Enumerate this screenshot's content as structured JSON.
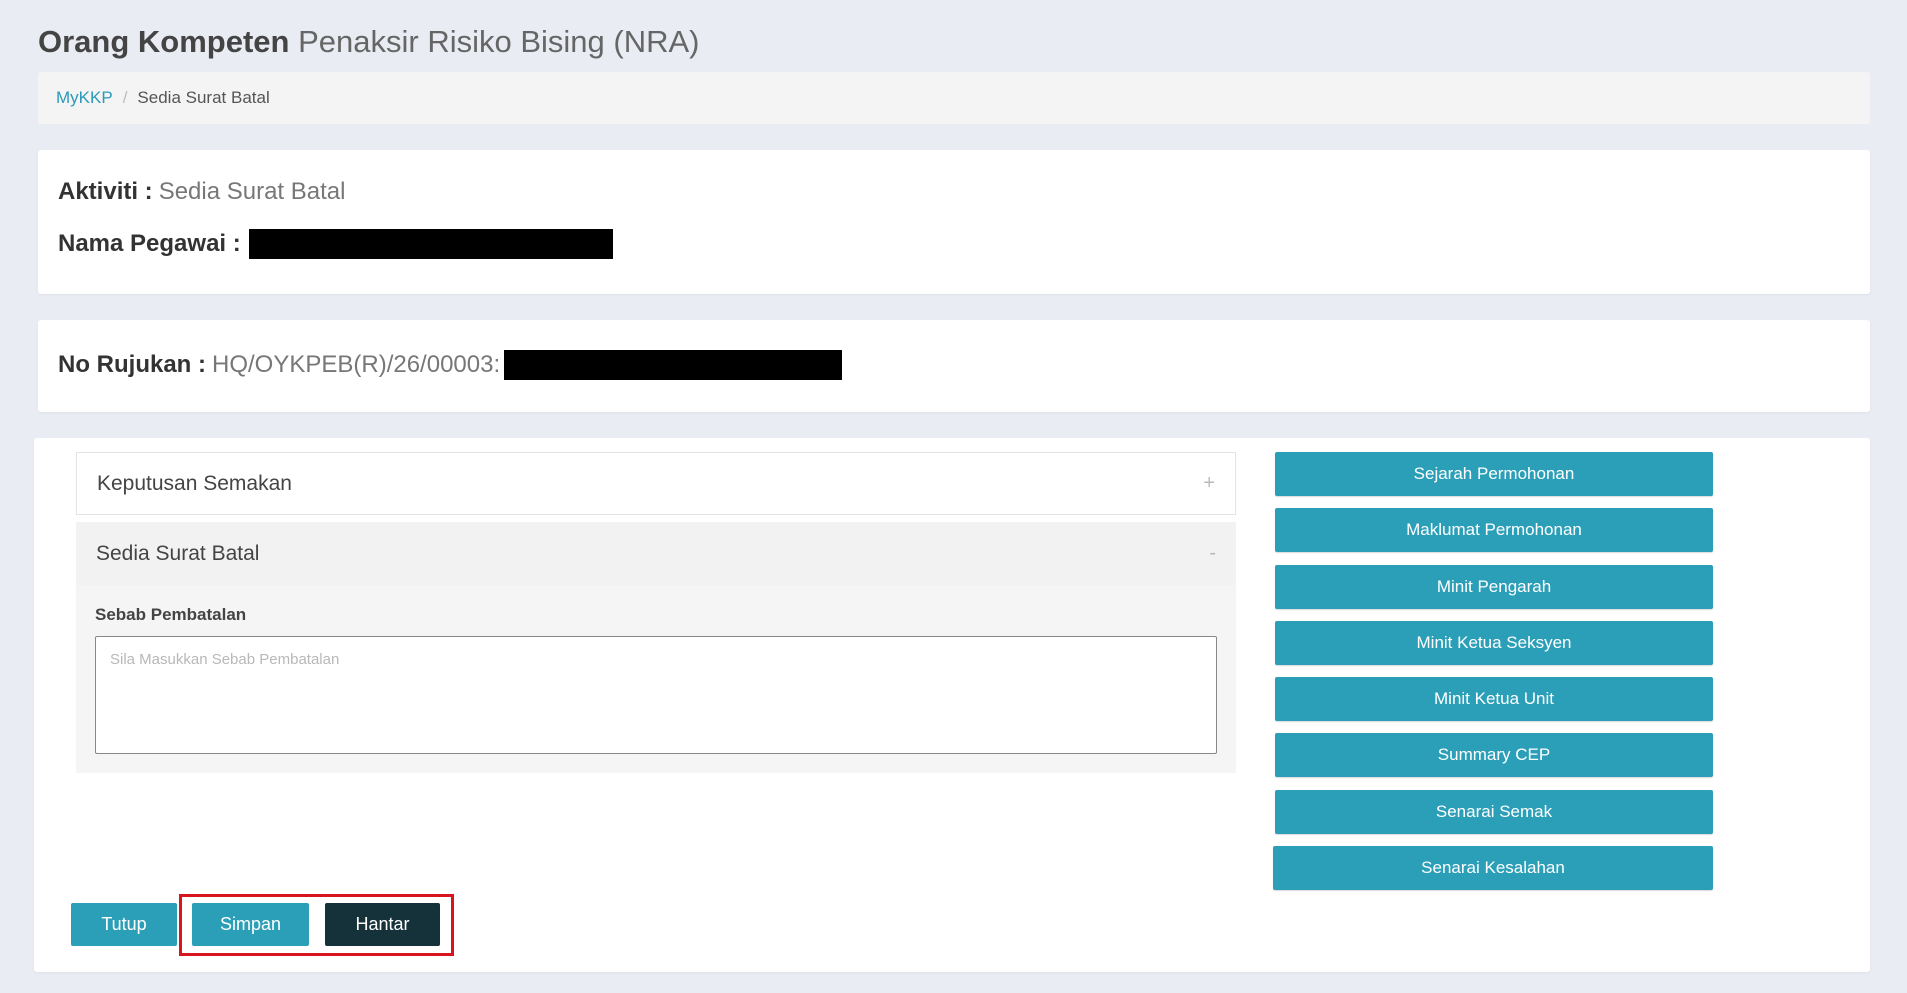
{
  "header": {
    "title_bold": "Orang Kompeten",
    "title_rest": "Penaksir Risiko Bising (NRA)"
  },
  "breadcrumb": {
    "home": "MyKKP",
    "separator": "/",
    "current": "Sedia Surat Batal"
  },
  "info": {
    "activity_label": "Aktiviti :",
    "activity_value": "Sedia Surat Batal",
    "officer_label": "Nama Pegawai :"
  },
  "reference": {
    "label": "No Rujukan :",
    "value": "HQ/OYKPEB(R)/26/00003:"
  },
  "accordion": {
    "collapsed_title": "Keputusan Semakan",
    "collapsed_toggle": "+",
    "open_title": "Sedia Surat Batal",
    "open_toggle": "-",
    "field_label": "Sebab Pembatalan",
    "field_placeholder": "Sila Masukkan Sebab Pembatalan",
    "field_value": ""
  },
  "side_buttons": [
    {
      "label": "Sejarah Permohonan"
    },
    {
      "label": "Maklumat Permohonan"
    },
    {
      "label": "Minit Pengarah"
    },
    {
      "label": "Minit Ketua Seksyen"
    },
    {
      "label": "Minit Ketua Unit"
    },
    {
      "label": "Summary CEP"
    },
    {
      "label": "Senarai Semak"
    },
    {
      "label": "Senarai Kesalahan"
    }
  ],
  "footer": {
    "close_label": "Tutup",
    "save_label": "Simpan",
    "submit_label": "Hantar"
  },
  "colors": {
    "accent": "#2c9fb8",
    "dark_button": "#15313a",
    "highlight": "#d8141c",
    "background": "#e9ecf3"
  }
}
